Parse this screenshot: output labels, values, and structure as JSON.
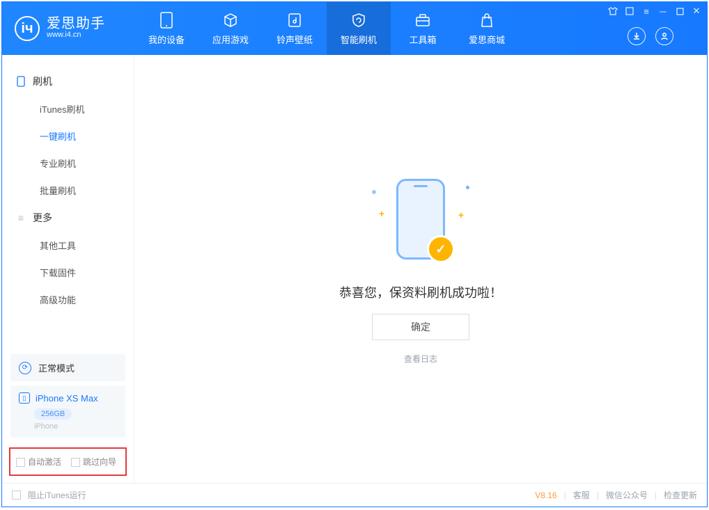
{
  "app": {
    "name_cn": "爱思助手",
    "name_en": "www.i4.cn"
  },
  "tabs": [
    {
      "label": "我的设备"
    },
    {
      "label": "应用游戏"
    },
    {
      "label": "铃声壁纸"
    },
    {
      "label": "智能刷机"
    },
    {
      "label": "工具箱"
    },
    {
      "label": "爱思商城"
    }
  ],
  "sidebar": {
    "group1": {
      "title": "刷机",
      "items": [
        "iTunes刷机",
        "一键刷机",
        "专业刷机",
        "批量刷机"
      ]
    },
    "group2": {
      "title": "更多",
      "items": [
        "其他工具",
        "下载固件",
        "高级功能"
      ]
    }
  },
  "mode": {
    "label": "正常模式"
  },
  "device": {
    "name": "iPhone XS Max",
    "capacity": "256GB",
    "type": "iPhone"
  },
  "options": {
    "auto_activate": "自动激活",
    "skip_guide": "跳过向导"
  },
  "main": {
    "success_text": "恭喜您，保资料刷机成功啦！",
    "ok_label": "确定",
    "log_link": "查看日志"
  },
  "footer": {
    "block_itunes": "阻止iTunes运行",
    "version": "V8.16",
    "links": [
      "客服",
      "微信公众号",
      "检查更新"
    ]
  }
}
